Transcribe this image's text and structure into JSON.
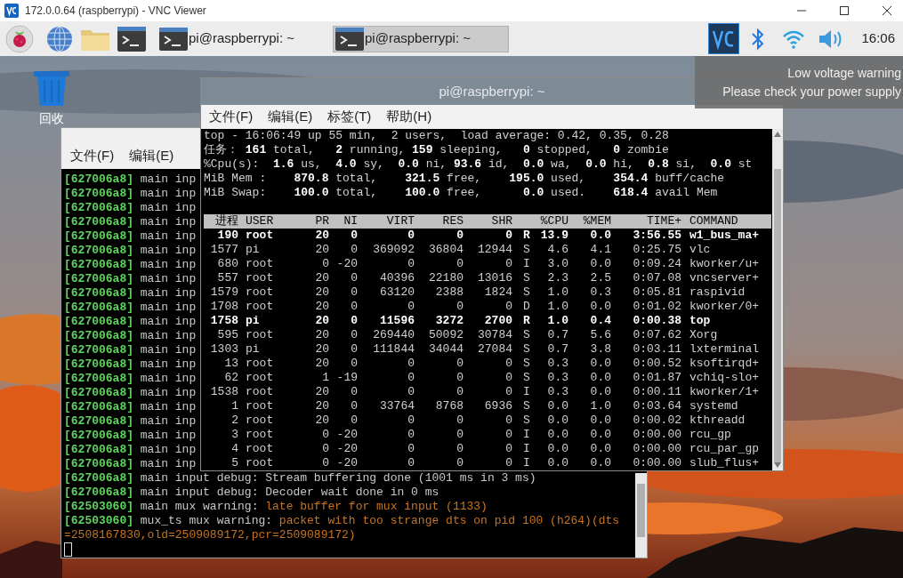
{
  "viewer_window": {
    "title": "172.0.0.64 (raspberrypi) - VNC Viewer"
  },
  "taskbar": {
    "tasks": [
      {
        "label": "pi@raspberrypi: ~",
        "selected": false
      },
      {
        "label": "pi@raspberrypi: ~",
        "selected": true
      }
    ],
    "clock": "16:06"
  },
  "tooltip": {
    "lines": [
      "Low voltage warning",
      "Please check your power supply"
    ]
  },
  "desktop_icons": [
    {
      "label": "回收"
    }
  ],
  "back_terminal": {
    "menu": [
      "文件(F)",
      "编辑(E)"
    ],
    "lines": [
      {
        "id": "[627006a8]",
        "text": "main inp"
      },
      {
        "id": "[627006a8]",
        "text": "main inp"
      },
      {
        "id": "[627006a8]",
        "text": "main inp"
      },
      {
        "id": "[627006a8]",
        "text": "main inp"
      },
      {
        "id": "[627006a8]",
        "text": "main inp"
      },
      {
        "id": "[627006a8]",
        "text": "main inp"
      },
      {
        "id": "[627006a8]",
        "text": "main inp"
      },
      {
        "id": "[627006a8]",
        "text": "main inp"
      },
      {
        "id": "[627006a8]",
        "text": "main inp"
      },
      {
        "id": "[627006a8]",
        "text": "main inp"
      },
      {
        "id": "[627006a8]",
        "text": "main inp"
      },
      {
        "id": "[627006a8]",
        "text": "main inp"
      },
      {
        "id": "[627006a8]",
        "text": "main inp"
      },
      {
        "id": "[627006a8]",
        "text": "main inp"
      },
      {
        "id": "[627006a8]",
        "text": "main inp"
      },
      {
        "id": "[627006a8]",
        "text": "main inp"
      },
      {
        "id": "[627006a8]",
        "text": "main inp"
      },
      {
        "id": "[627006a8]",
        "text": "main inp"
      },
      {
        "id": "[627006a8]",
        "text": "main inp"
      },
      {
        "id": "[627006a8]",
        "text": "main inp"
      },
      {
        "id": "[627006a8]",
        "text": "main inp"
      },
      {
        "id": "[627006a8]",
        "text": "main input debug: Stream buffering done (1001 ms in 3 ms)"
      },
      {
        "id": "[627006a8]",
        "text": "main input debug: Decoder wait done in 0 ms"
      },
      {
        "id": "[62503060]",
        "text": "main mux warning: ",
        "warning": "late buffer for mux input (1133)"
      },
      {
        "id": "[62503060]",
        "text": "mux_ts mux warning: ",
        "warning": "packet with too strange dts on pid 100 (h264)(dts=2508167830,old=2509089172,pcr=2509089172)"
      }
    ]
  },
  "front_terminal": {
    "title": "pi@raspberrypi: ~",
    "menu": [
      "文件(F)",
      "编辑(E)",
      "标签(T)",
      "帮助(H)"
    ],
    "summary": [
      "top - 16:06:49 up 55 min,  2 users,  load average: 0.42, 0.35, 0.28",
      "任务： **161** total,   **2** running, **159** sleeping,   **0** stopped,   **0** zombie",
      "%Cpu(s):  **1.6** us,  **4.0** sy,  **0.0** ni, **93.6** id,  **0.0** wa,  **0.0** hi,  **0.8** si,  **0.0** st",
      "MiB Mem :    **870.8** total,    **321.5** free,    **195.0** used,    **354.4** buff/cache",
      "MiB Swap:    **100.0** total,    **100.0** free,      **0.0** used.    **618.4** avail Mem"
    ],
    "columns": [
      "进程",
      "USER",
      "PR",
      "NI",
      "VIRT",
      "RES",
      "SHR",
      "%CPU",
      "%MEM",
      "TIME+",
      "COMMAND"
    ],
    "processes": [
      {
        "pid": "190",
        "user": "root",
        "pr": "20",
        "ni": "0",
        "virt": "0",
        "res": "0",
        "shr": "0",
        "s": "R",
        "cpu": "13.9",
        "mem": "0.0",
        "time": "3:56.55",
        "command": "w1_bus_ma+",
        "highlighted": true
      },
      {
        "pid": "1577",
        "user": "pi",
        "pr": "20",
        "ni": "0",
        "virt": "369092",
        "res": "36804",
        "shr": "12944",
        "s": "S",
        "cpu": "4.6",
        "mem": "4.1",
        "time": "0:25.75",
        "command": "vlc",
        "highlighted": false
      },
      {
        "pid": "680",
        "user": "root",
        "pr": "0",
        "ni": "-20",
        "virt": "0",
        "res": "0",
        "shr": "0",
        "s": "I",
        "cpu": "3.0",
        "mem": "0.0",
        "time": "0:09.24",
        "command": "kworker/u+",
        "highlighted": false
      },
      {
        "pid": "557",
        "user": "root",
        "pr": "20",
        "ni": "0",
        "virt": "40396",
        "res": "22180",
        "shr": "13016",
        "s": "S",
        "cpu": "2.3",
        "mem": "2.5",
        "time": "0:07.08",
        "command": "vncserver+",
        "highlighted": false
      },
      {
        "pid": "1579",
        "user": "root",
        "pr": "20",
        "ni": "0",
        "virt": "63120",
        "res": "2388",
        "shr": "1824",
        "s": "S",
        "cpu": "1.0",
        "mem": "0.3",
        "time": "0:05.81",
        "command": "raspivid",
        "highlighted": false
      },
      {
        "pid": "1708",
        "user": "root",
        "pr": "20",
        "ni": "0",
        "virt": "0",
        "res": "0",
        "shr": "0",
        "s": "D",
        "cpu": "1.0",
        "mem": "0.0",
        "time": "0:01.02",
        "command": "kworker/0+",
        "highlighted": false
      },
      {
        "pid": "1758",
        "user": "pi",
        "pr": "20",
        "ni": "0",
        "virt": "11596",
        "res": "3272",
        "shr": "2700",
        "s": "R",
        "cpu": "1.0",
        "mem": "0.4",
        "time": "0:00.38",
        "command": "top",
        "highlighted": true
      },
      {
        "pid": "595",
        "user": "root",
        "pr": "20",
        "ni": "0",
        "virt": "269440",
        "res": "50092",
        "shr": "30784",
        "s": "S",
        "cpu": "0.7",
        "mem": "5.6",
        "time": "0:07.62",
        "command": "Xorg",
        "highlighted": false
      },
      {
        "pid": "1303",
        "user": "pi",
        "pr": "20",
        "ni": "0",
        "virt": "111844",
        "res": "34044",
        "shr": "27084",
        "s": "S",
        "cpu": "0.7",
        "mem": "3.8",
        "time": "0:03.11",
        "command": "lxterminal",
        "highlighted": false
      },
      {
        "pid": "13",
        "user": "root",
        "pr": "20",
        "ni": "0",
        "virt": "0",
        "res": "0",
        "shr": "0",
        "s": "S",
        "cpu": "0.3",
        "mem": "0.0",
        "time": "0:00.52",
        "command": "ksoftirqd+",
        "highlighted": false
      },
      {
        "pid": "62",
        "user": "root",
        "pr": "1",
        "ni": "-19",
        "virt": "0",
        "res": "0",
        "shr": "0",
        "s": "S",
        "cpu": "0.3",
        "mem": "0.0",
        "time": "0:01.87",
        "command": "vchiq-slo+",
        "highlighted": false
      },
      {
        "pid": "1538",
        "user": "root",
        "pr": "20",
        "ni": "0",
        "virt": "0",
        "res": "0",
        "shr": "0",
        "s": "I",
        "cpu": "0.3",
        "mem": "0.0",
        "time": "0:00.11",
        "command": "kworker/1+",
        "highlighted": false
      },
      {
        "pid": "1",
        "user": "root",
        "pr": "20",
        "ni": "0",
        "virt": "33764",
        "res": "8768",
        "shr": "6936",
        "s": "S",
        "cpu": "0.0",
        "mem": "1.0",
        "time": "0:03.64",
        "command": "systemd",
        "highlighted": false
      },
      {
        "pid": "2",
        "user": "root",
        "pr": "20",
        "ni": "0",
        "virt": "0",
        "res": "0",
        "shr": "0",
        "s": "S",
        "cpu": "0.0",
        "mem": "0.0",
        "time": "0:00.02",
        "command": "kthreadd",
        "highlighted": false
      },
      {
        "pid": "3",
        "user": "root",
        "pr": "0",
        "ni": "-20",
        "virt": "0",
        "res": "0",
        "shr": "0",
        "s": "I",
        "cpu": "0.0",
        "mem": "0.0",
        "time": "0:00.00",
        "command": "rcu_gp",
        "highlighted": false
      },
      {
        "pid": "4",
        "user": "root",
        "pr": "0",
        "ni": "-20",
        "virt": "0",
        "res": "0",
        "shr": "0",
        "s": "I",
        "cpu": "0.0",
        "mem": "0.0",
        "time": "0:00.00",
        "command": "rcu_par_gp",
        "highlighted": false
      },
      {
        "pid": "5",
        "user": "root",
        "pr": "0",
        "ni": "-20",
        "virt": "0",
        "res": "0",
        "shr": "0",
        "s": "I",
        "cpu": "0.0",
        "mem": "0.0",
        "time": "0:00.00",
        "command": "slub_flus+",
        "highlighted": false
      }
    ]
  }
}
